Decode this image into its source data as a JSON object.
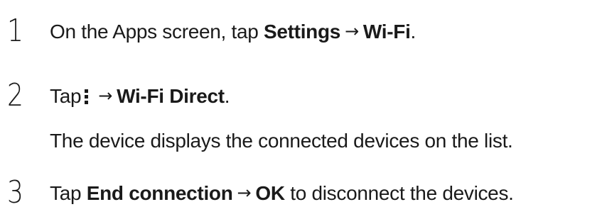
{
  "steps": [
    {
      "number": "1",
      "parts": {
        "a": "On the Apps screen, tap ",
        "b": "Settings",
        "arrow": "→",
        "c": "Wi-Fi",
        "d": "."
      }
    },
    {
      "number": "2",
      "parts": {
        "a": "Tap",
        "icon": "more-options-icon",
        "arrow": "→",
        "b": "Wi-Fi Direct",
        "c": "."
      },
      "note": "The device displays the connected devices on the list."
    },
    {
      "number": "3",
      "parts": {
        "a": "Tap ",
        "b": "End connection",
        "arrow": "→",
        "c": "OK",
        "d": " to disconnect the devices."
      }
    }
  ]
}
